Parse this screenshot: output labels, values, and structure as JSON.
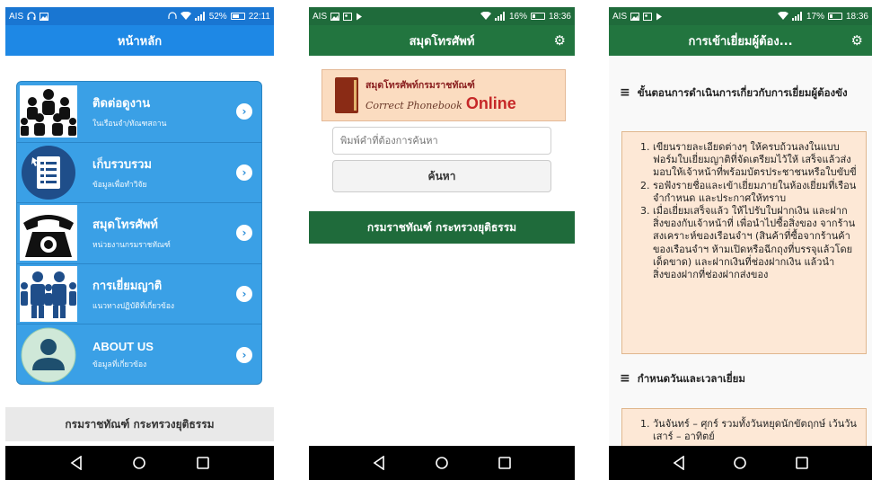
{
  "colors": {
    "blue_bar": "#1e88e5",
    "blue_menu": "#3aa0e6",
    "green_bar": "#22753f",
    "panel_bg": "#fde8d6"
  },
  "phone1": {
    "status": {
      "carrier": "AIS",
      "battery": "52%",
      "time": "22:11"
    },
    "title": "หน้าหลัก",
    "menu": [
      {
        "title": "ติดต่อดูงาน",
        "subtitle": "ในเรือนจำ/ทัณฑสถาน",
        "icon": "people-group-icon"
      },
      {
        "title": "เก็บรวบรวม",
        "subtitle": "ข้อมูลเพื่อทำวิจัย",
        "icon": "document-list-icon"
      },
      {
        "title": "สมุดโทรศัพท์",
        "subtitle": "หน่วยงานกรมราชทัณฑ์",
        "icon": "telephone-icon"
      },
      {
        "title": "การเยี่ยมญาติ",
        "subtitle": "แนวทางปฏิบัติที่เกี่ยวข้อง",
        "icon": "family-icon"
      },
      {
        "title": "ABOUT US",
        "subtitle": "ข้อมูลที่เกี่ยวข้อง",
        "icon": "user-icon"
      }
    ],
    "footer": "กรมราชทัณฑ์ กระทรวงยุติธรรม"
  },
  "phone2": {
    "status": {
      "carrier": "AIS",
      "battery": "16%",
      "time": "18:36"
    },
    "title": "สมุดโทรศัพท์",
    "banner": {
      "thai": "สมุดโทรศัพท์กรมราชทัณฑ์",
      "script": "Correct Phonebook",
      "online": "Online"
    },
    "search_placeholder": "พิมพ์คำที่ต้องการค้นหา",
    "search_button": "ค้นหา",
    "footer": "กรมราชทัณฑ์ กระทรวงยุติธรรม"
  },
  "phone3": {
    "status": {
      "carrier": "AIS",
      "battery": "17%",
      "time": "18:36"
    },
    "title": "การเข้าเยี่ยมผู้ต้อง...",
    "section1_title": "ขั้นตอนการดำเนินการเกี่ยวกับการเยี่ยมผู้ต้องขัง",
    "section1_items": [
      "เขียนรายละเอียดต่างๆ ให้ครบถ้วนลงในแบบฟอร์มใบเยี่ยมญาติที่จัดเตรียมไว้ให้ เสร็จแล้วส่งมอบให้เจ้าหน้าที่พร้อมบัตรประชาชนหรือใบขับขี่",
      "รอฟังรายชื่อและเข้าเยี่ยมภายในห้องเยี่ยมที่เรือนจำกำหนด และประกาศให้ทราบ",
      "เมื่อเยี่ยมเสร็จแล้ว ให้ไปรับใบฝากเงิน และฝากสิ่งของกับเจ้าหน้าที่ เพื่อนำไปซื้อสิ่งของ จากร้านสงเคราะห์ของเรือนจำฯ (สินค้าที่ซื้อจากร้านค้าของเรือนจำฯ ห้ามเปิดหรือฉีกถุงที่บรรจุแล้วโดยเด็ดขาด) และฝากเงินที่ช่องฝากเงิน แล้วนำสิ่งของฝากที่ช่องฝากส่งของ"
    ],
    "section2_title": "กำหนดวันและเวลาเยี่ยม",
    "section2_items": [
      "วันจันทร์ – ศุกร์ รวมทั้งวันหยุดนักขัตฤกษ์ เว้นวันเสาร์ – อาทิตย์"
    ]
  }
}
